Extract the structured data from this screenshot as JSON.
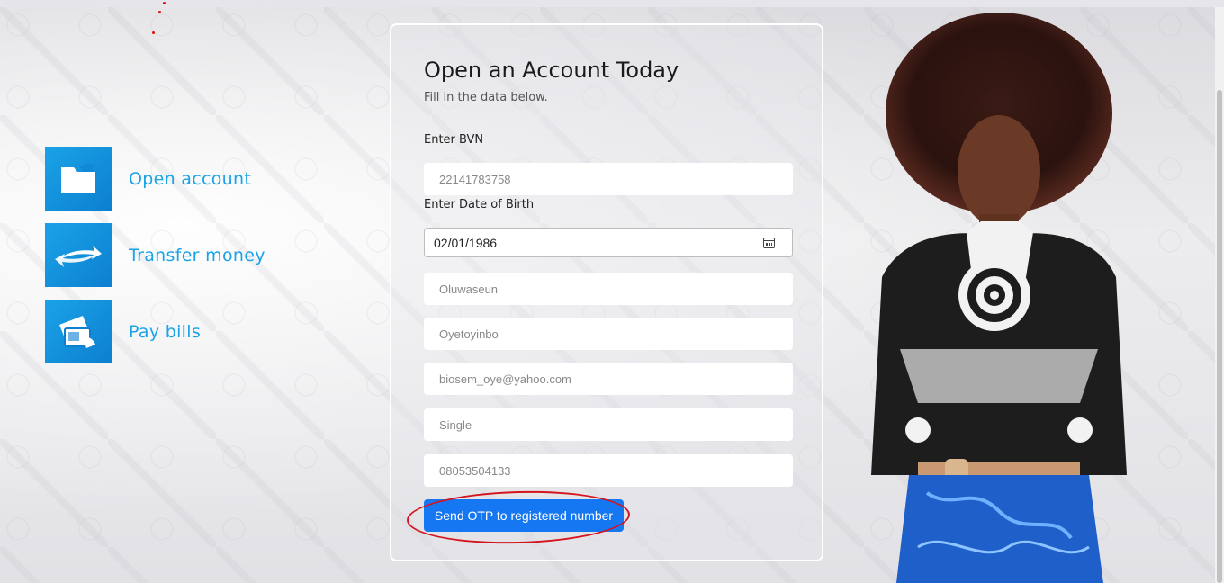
{
  "features": [
    {
      "label": "Open account",
      "icon": "folder-icon"
    },
    {
      "label": "Transfer money",
      "icon": "transfer-arrows-icon"
    },
    {
      "label": "Pay bills",
      "icon": "bill-payment-icon"
    }
  ],
  "form": {
    "title": "Open an Account Today",
    "subtitle": "Fill in the data below.",
    "bvn_label": "Enter BVN",
    "bvn_placeholder": "22141783758",
    "dob_label": "Enter Date of Birth",
    "dob_value": "02/01/1986",
    "first_name_placeholder": "Oluwaseun",
    "last_name_placeholder": "Oyetoyinbo",
    "email_placeholder": "biosem_oye@yahoo.com",
    "marital_status_placeholder": "Single",
    "phone_placeholder": "08053504133",
    "submit_label": "Send OTP to registered number"
  },
  "colors": {
    "accent": "#1aa3e6",
    "button": "#1677f2",
    "annotation": "#d4141e"
  }
}
